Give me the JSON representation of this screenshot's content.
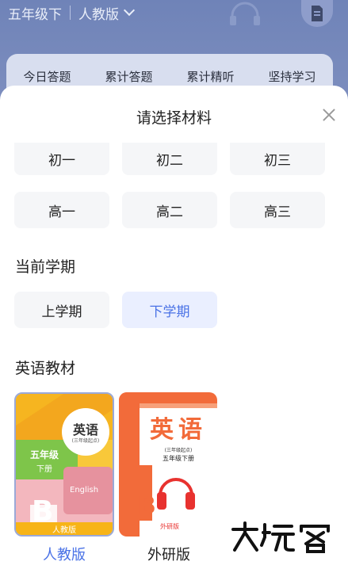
{
  "background": {
    "grade": "五年级下",
    "edition": "人教版",
    "stats": [
      "今日答题",
      "累计答题",
      "累计精听",
      "坚持学习"
    ]
  },
  "sheet": {
    "title": "请选择材料",
    "grades_row1": [
      "初一",
      "初二",
      "初三"
    ],
    "grades_row2": [
      "高一",
      "高二",
      "高三"
    ],
    "semester_label": "当前学期",
    "semesters": [
      "上学期",
      "下学期"
    ],
    "selected_semester": "下学期",
    "textbook_label": "英语教材",
    "books": [
      {
        "caption": "人教版",
        "selected": true,
        "cover_title": "英语",
        "cover_subtitle": "(三年级起点)",
        "cover_grade": "五年级",
        "cover_volume": "下册",
        "cover_letter": "B",
        "cover_english": "English",
        "cover_publisher": "人教版"
      },
      {
        "caption": "外研版",
        "selected": false,
        "cover_title": "英语",
        "cover_subtitle": "(三年级起点)",
        "cover_grade": "五年级下册",
        "cover_letter": "B",
        "cover_publisher": "外研版"
      }
    ],
    "watermark": "大玩客"
  },
  "colors": {
    "accent": "#4a72e6",
    "selected_bg": "#eaefff",
    "chip_bg": "#f5f6f8",
    "header_bg": "#7385bb"
  }
}
